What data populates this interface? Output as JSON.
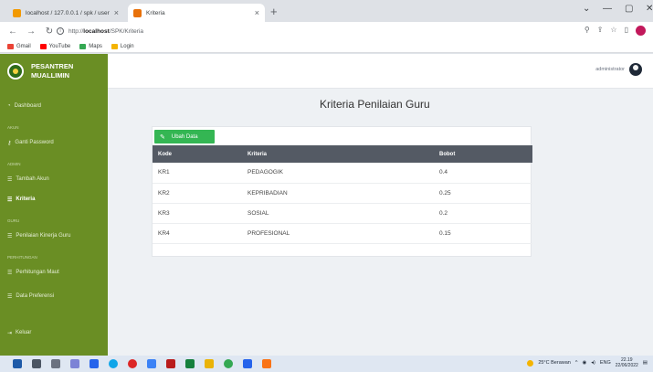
{
  "browser": {
    "tabs": [
      {
        "title": "localhost / 127.0.0.1 / spk / user",
        "favicon_color": "#f29900"
      },
      {
        "title": "Kriteria",
        "favicon_color": "#e8710a"
      }
    ],
    "url_protocol": "http://",
    "url_host": "localhost",
    "url_path": "/SPK/Kriteria",
    "bookmarks": [
      {
        "label": "Gmail",
        "color": "#ea4335"
      },
      {
        "label": "YouTube",
        "color": "#ff0000"
      },
      {
        "label": "Maps",
        "color": "#34a853"
      },
      {
        "label": "Login",
        "color": "#f4b400"
      }
    ]
  },
  "app": {
    "brand_line1": "PESANTREN",
    "brand_line2": "MUALLIMIN",
    "accent_color": "#6a8e24",
    "user_name": "administrator"
  },
  "sidebar": {
    "dashboard": "Dashboard",
    "section_akun": "AKUN",
    "ganti_password": "Ganti Password",
    "section_admin": "ADMIN",
    "tambah_akun": "Tambah Akun",
    "kriteria": "Kriteria",
    "section_guru": "GURU",
    "penilaian": "Penilaian Kinerja Guru",
    "section_perhitungan": "PERHITUNGAN",
    "perhitungan_maut": "Perhitungan Maut",
    "data_preferensi": "Data Preferensi",
    "keluar": "Keluar"
  },
  "main": {
    "title": "Kriteria Penilaian Guru",
    "edit_button": "Ubah Data",
    "columns": [
      "Kode",
      "Kriteria",
      "Bobot"
    ],
    "rows": [
      [
        "KR1",
        "PEDAGOGIK",
        "0.4"
      ],
      [
        "KR2",
        "KEPRIBADIAN",
        "0.25"
      ],
      [
        "KR3",
        "SOSIAL",
        "0.2"
      ],
      [
        "KR4",
        "PROFESIONAL",
        "0.15"
      ]
    ]
  },
  "taskbar": {
    "weather": "25°C Berawan",
    "language": "ENG",
    "time": "22.19",
    "date": "22/06/2022"
  }
}
